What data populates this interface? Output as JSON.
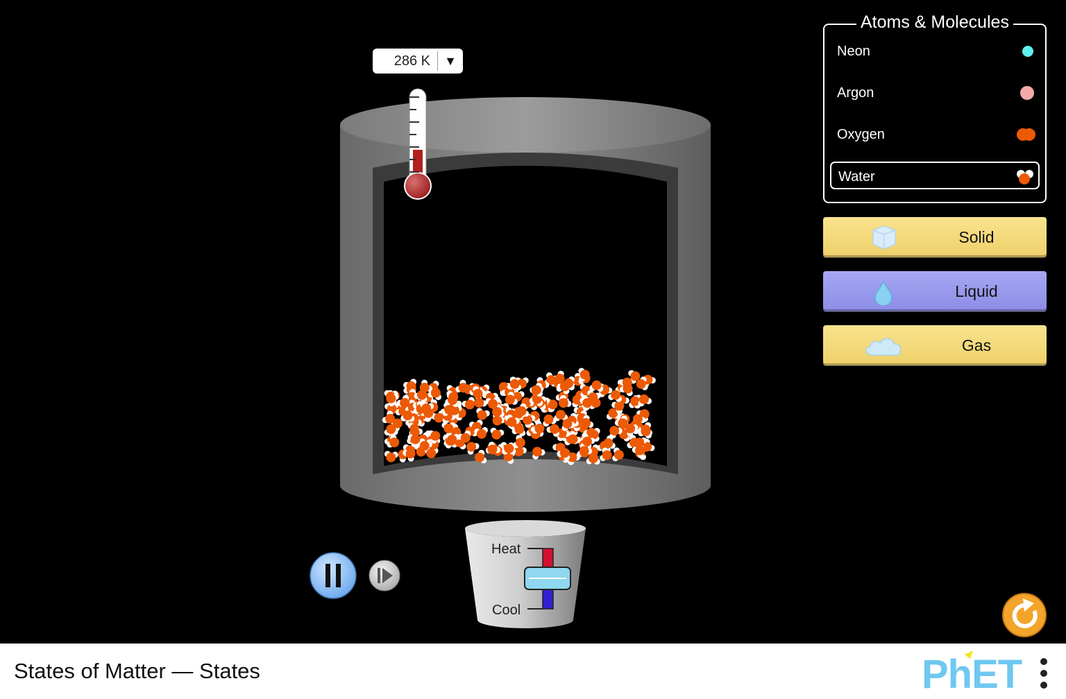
{
  "temperature": {
    "value": "286 K",
    "dropdown_glyph": "▼"
  },
  "molecule_panel": {
    "title": "Atoms & Molecules",
    "items": [
      {
        "label": "Neon",
        "icon": "neon-atom-icon",
        "color": "#5ff0f0",
        "selected": false
      },
      {
        "label": "Argon",
        "icon": "argon-atom-icon",
        "color": "#f4a9a9",
        "selected": false
      },
      {
        "label": "Oxygen",
        "icon": "oxygen-molecule-icon",
        "color": "#ec5a06",
        "selected": false
      },
      {
        "label": "Water",
        "icon": "water-molecule-icon",
        "color": "#ec5a06",
        "selected": true
      }
    ]
  },
  "state_buttons": {
    "solid": "Solid",
    "liquid": "Liquid",
    "gas": "Gas"
  },
  "heater": {
    "heat_label": "Heat",
    "cool_label": "Cool",
    "level": 0
  },
  "playback": {
    "state": "playing"
  },
  "nav": {
    "title": "States of Matter — States",
    "logo_text": "PhET"
  },
  "colors": {
    "oxygen_atom": "#ec5a06",
    "hydrogen_atom": "#ffffff",
    "liquid_button": "#9a9aee",
    "state_button": "#f3db7c",
    "reset": "#f3a52b"
  }
}
